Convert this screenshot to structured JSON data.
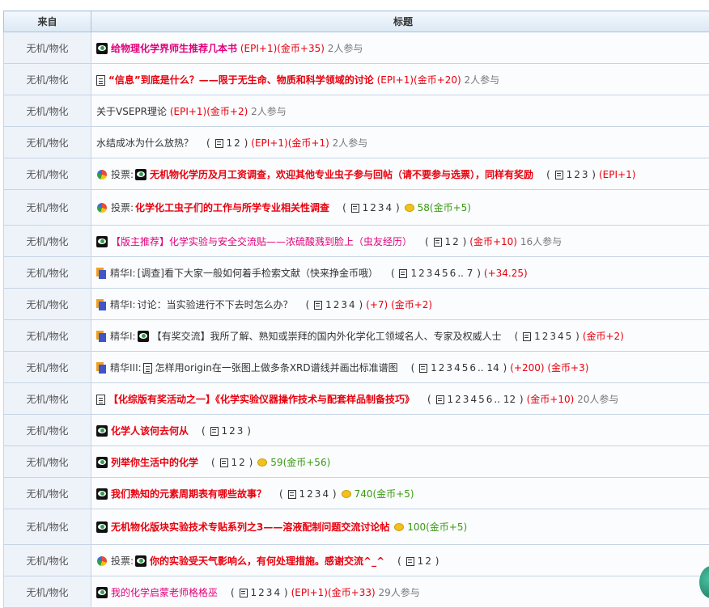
{
  "header": {
    "col_source": "来自",
    "col_title": "标题"
  },
  "rows": [
    {
      "source": "无机/物化",
      "icon": "hot-icon",
      "prefix": "",
      "icon2": "",
      "title": "给物理化学界师生推荐几本书",
      "style": "t-pink",
      "pages": [],
      "pages_suffix": "",
      "meta": [
        {
          "text": "(EPI+1)(金币+35)",
          "cls": "meta-red"
        },
        {
          "text": "2人参与",
          "cls": "meta-gray"
        }
      ]
    },
    {
      "source": "无机/物化",
      "icon": "doc-icon",
      "prefix": "",
      "icon2": "",
      "title": "“信息”到底是什么？——限于无生命、物质和科学领域的讨论",
      "style": "t-red",
      "pages": [],
      "pages_suffix": "",
      "meta": [
        {
          "text": "(EPI+1)(金币+20)",
          "cls": "meta-red"
        },
        {
          "text": "2人参与",
          "cls": "meta-gray"
        }
      ]
    },
    {
      "source": "无机/物化",
      "icon": "",
      "prefix": "",
      "icon2": "",
      "title": "关于VSEPR理论",
      "style": "t-plain",
      "pages": [],
      "pages_suffix": "",
      "meta": [
        {
          "text": "(EPI+1)(金币+2)",
          "cls": "meta-red"
        },
        {
          "text": "2人参与",
          "cls": "meta-gray"
        }
      ]
    },
    {
      "source": "无机/物化",
      "icon": "",
      "prefix": "",
      "icon2": "",
      "title": "水结成冰为什么放热？",
      "style": "t-plain",
      "pages": [
        "1",
        "2"
      ],
      "pages_suffix": "",
      "meta": [
        {
          "text": "(EPI+1)(金币+1)",
          "cls": "meta-red"
        },
        {
          "text": "2人参与",
          "cls": "meta-gray"
        }
      ]
    },
    {
      "source": "无机/物化",
      "icon": "poll-icon",
      "prefix": "投票:",
      "icon2": "hot-icon",
      "title": "无机物化学历及月工资调查，欢迎其他专业虫子参与回帖（请不要参与选票），同样有奖励",
      "style": "t-red",
      "pages": [
        "1",
        "2",
        "3"
      ],
      "pages_suffix": "",
      "meta": [
        {
          "text": "(EPI+1)",
          "cls": "meta-red"
        }
      ]
    },
    {
      "source": "无机/物化",
      "icon": "poll-icon",
      "prefix": "投票:",
      "icon2": "",
      "title": "化学化工虫子们的工作与所学专业相关性调查",
      "style": "t-red",
      "pages": [
        "1",
        "2",
        "3",
        "4"
      ],
      "pages_suffix": "",
      "meta": [
        {
          "text": "coin",
          "cls": "coin"
        },
        {
          "text": "58(金币+5)",
          "cls": "meta-green"
        }
      ]
    },
    {
      "source": "无机/物化",
      "icon": "hot-icon",
      "prefix": "",
      "icon2": "",
      "title": "【版主推荐】化学实验与安全交流贴——浓硫酸溅到脸上（虫友经历）",
      "style": "t-pinkn",
      "pages": [
        "1",
        "2"
      ],
      "pages_suffix": "",
      "meta": [
        {
          "text": "(金币+10)",
          "cls": "meta-red"
        },
        {
          "text": "16人参与",
          "cls": "meta-gray"
        }
      ]
    },
    {
      "source": "无机/物化",
      "icon": "digest-icon",
      "prefix": "精华I:",
      "icon2": "",
      "title": "[调查]看下大家一般如何着手检索文献（快来挣金币哦）",
      "style": "t-plain",
      "pages": [
        "1",
        "2",
        "3",
        "4",
        "5",
        "6"
      ],
      "pages_suffix": ".. 7",
      "meta": [
        {
          "text": "(+34.25)",
          "cls": "meta-red"
        }
      ]
    },
    {
      "source": "无机/物化",
      "icon": "digest-icon",
      "prefix": "精华I:",
      "icon2": "",
      "title": "讨论：当实验进行不下去时怎么办？",
      "style": "t-plain",
      "pages": [
        "1",
        "2",
        "3",
        "4"
      ],
      "pages_suffix": "",
      "meta": [
        {
          "text": "(+7)",
          "cls": "meta-red"
        },
        {
          "text": "(金币+2)",
          "cls": "meta-red"
        }
      ]
    },
    {
      "source": "无机/物化",
      "icon": "digest-icon",
      "prefix": "精华I:",
      "icon2": "hot-icon",
      "title": "【有奖交流】我所了解、熟知或崇拜的国内外化学化工领域名人、专家及权威人士",
      "style": "t-plain",
      "pages": [
        "1",
        "2",
        "3",
        "4",
        "5"
      ],
      "pages_suffix": "",
      "meta": [
        {
          "text": "(金币+2)",
          "cls": "meta-red"
        }
      ]
    },
    {
      "source": "无机/物化",
      "icon": "digest-icon",
      "prefix": "精华III:",
      "icon2": "doc-icon",
      "title": "怎样用origin在一张图上做多条XRD谱线并画出标准谱图",
      "style": "t-plain",
      "pages": [
        "1",
        "2",
        "3",
        "4",
        "5",
        "6"
      ],
      "pages_suffix": ".. 14",
      "meta": [
        {
          "text": "(+200)",
          "cls": "meta-red"
        },
        {
          "text": "(金币+3)",
          "cls": "meta-red"
        }
      ]
    },
    {
      "source": "无机/物化",
      "icon": "doc-icon",
      "prefix": "",
      "icon2": "",
      "title": "【化综版有奖活动之一】《化学实验仪器操作技术与配套样品制备技巧》",
      "style": "t-red",
      "pages": [
        "1",
        "2",
        "3",
        "4",
        "5",
        "6"
      ],
      "pages_suffix": ".. 12",
      "meta": [
        {
          "text": "(金币+10)",
          "cls": "meta-red"
        },
        {
          "text": "20人参与",
          "cls": "meta-gray"
        }
      ]
    },
    {
      "source": "无机/物化",
      "icon": "hot-icon",
      "prefix": "",
      "icon2": "",
      "title": "化学人该何去何从",
      "style": "t-red",
      "pages": [
        "1",
        "2",
        "3"
      ],
      "pages_suffix": "",
      "meta": []
    },
    {
      "source": "无机/物化",
      "icon": "hot-icon",
      "prefix": "",
      "icon2": "",
      "title": "列举你生活中的化学",
      "style": "t-red",
      "pages": [
        "1",
        "2"
      ],
      "pages_suffix": "",
      "meta": [
        {
          "text": "coin",
          "cls": "coin"
        },
        {
          "text": "59(金币+56)",
          "cls": "meta-green"
        }
      ]
    },
    {
      "source": "无机/物化",
      "icon": "hot-icon",
      "prefix": "",
      "icon2": "",
      "title": "我们熟知的元素周期表有哪些故事？",
      "style": "t-red",
      "pages": [
        "1",
        "2",
        "3",
        "4"
      ],
      "pages_suffix": "",
      "meta": [
        {
          "text": "coin",
          "cls": "coin"
        },
        {
          "text": "740(金币+5)",
          "cls": "meta-green"
        }
      ]
    },
    {
      "source": "无机/物化",
      "icon": "hot-icon",
      "prefix": "",
      "icon2": "",
      "title": "无机物化版块实验技术专贴系列之3——溶液配制问题交流讨论帖",
      "style": "t-red",
      "pages": [],
      "pages_suffix": "",
      "meta": [
        {
          "text": "coin",
          "cls": "coin"
        },
        {
          "text": "100(金币+5)",
          "cls": "meta-green"
        }
      ]
    },
    {
      "source": "无机/物化",
      "icon": "poll-icon",
      "prefix": "投票:",
      "icon2": "hot-icon",
      "title": "你的实验受天气影响么，有何处理措施。感谢交流^_^",
      "style": "t-red",
      "pages": [
        "1",
        "2"
      ],
      "pages_suffix": "",
      "meta": []
    },
    {
      "source": "无机/物化",
      "icon": "hot-icon",
      "prefix": "",
      "icon2": "",
      "title": "我的化学启蒙老师格格巫",
      "style": "t-pinkn",
      "pages": [
        "1",
        "2",
        "3",
        "4"
      ],
      "pages_suffix": "",
      "meta": [
        {
          "text": "(EPI+1)(金币+33)",
          "cls": "meta-red"
        },
        {
          "text": "29人参与",
          "cls": "meta-gray"
        }
      ]
    }
  ]
}
